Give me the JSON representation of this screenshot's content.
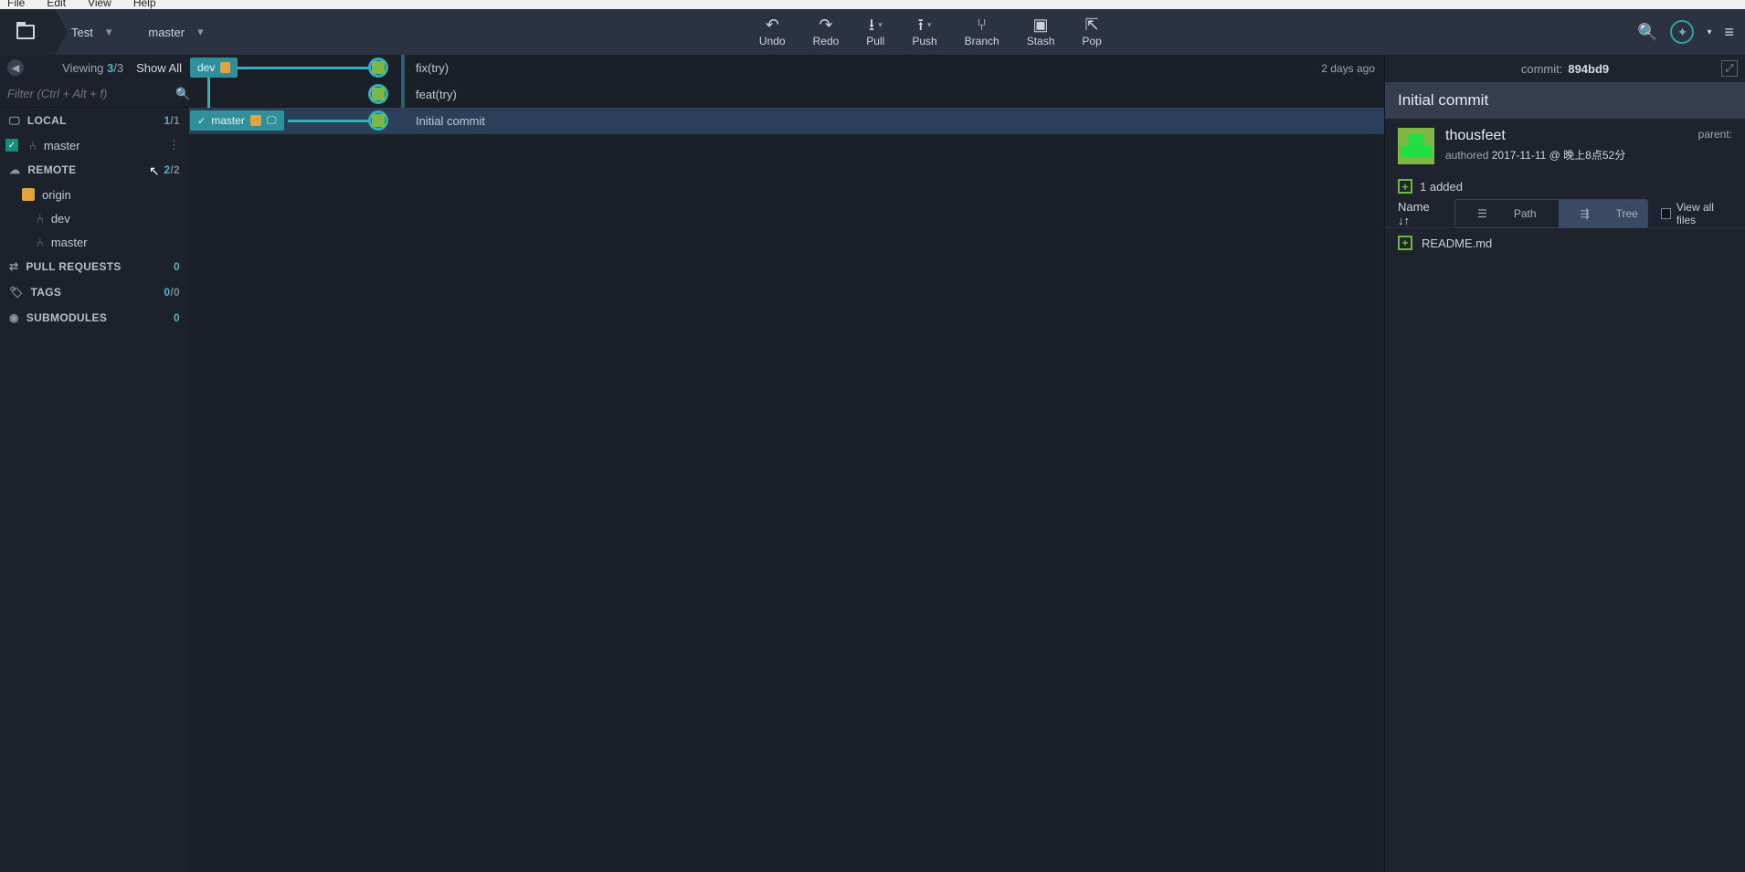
{
  "menubar": {
    "file": "File",
    "edit": "Edit",
    "view": "View",
    "help": "Help"
  },
  "breadcrumb": {
    "repo": "Test",
    "branch": "master"
  },
  "toolbar": {
    "undo": "Undo",
    "redo": "Redo",
    "pull": "Pull",
    "push": "Push",
    "branch": "Branch",
    "stash": "Stash",
    "pop": "Pop"
  },
  "sidebar": {
    "viewing_label": "Viewing",
    "viewing_count": "3",
    "viewing_total": "/3",
    "show_all": "Show All",
    "filter_placeholder": "Filter (Ctrl + Alt + f)",
    "local": {
      "label": "LOCAL",
      "count": "1",
      "total": "/1",
      "items": [
        "master"
      ]
    },
    "remote": {
      "label": "REMOTE",
      "count": "2",
      "total": "/2",
      "origin": "origin",
      "items": [
        "dev",
        "master"
      ]
    },
    "pull_requests": {
      "label": "PULL REQUESTS",
      "count": "0"
    },
    "tags": {
      "label": "TAGS",
      "count": "0",
      "total": "/0"
    },
    "submodules": {
      "label": "SUBMODULES",
      "count": "0"
    }
  },
  "commits": [
    {
      "branch_tag": "dev",
      "message": "fix(try)",
      "time": "2 days ago"
    },
    {
      "branch_tag": null,
      "message": "feat(try)",
      "time": ""
    },
    {
      "branch_tag": "master",
      "message": "Initial commit",
      "time": ""
    }
  ],
  "details": {
    "commit_label": "commit:",
    "hash": "894bd9",
    "title": "Initial commit",
    "author": "thousfeet",
    "authored_label": "authored",
    "date": "2017-11-11 @ 晚上8点52分",
    "parent_label": "parent:",
    "added_label": "1 added",
    "columns": {
      "name": "Name",
      "path": "Path",
      "tree": "Tree",
      "view_all": "View all files"
    },
    "files": [
      "README.md"
    ]
  }
}
